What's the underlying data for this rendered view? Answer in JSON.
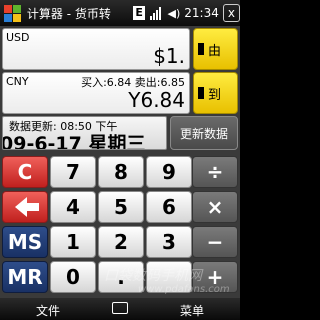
{
  "statusbar": {
    "app_title": "计算器 - 货币转",
    "badge": "E",
    "time": "21:34",
    "close": "x"
  },
  "converter": {
    "from_code": "USD",
    "from_value": "$1.",
    "to_code": "CNY",
    "to_value": "Y6.84",
    "rate_text": "买入:6.84 卖出:6.85",
    "from_button": "由",
    "to_button": "到"
  },
  "info": {
    "update_text": "数据更新:  08:50 下午",
    "date_text": "09-6-17 星期三",
    "update_button": "更新数据"
  },
  "keypad": {
    "clear": "C",
    "backspace": "backspace",
    "ms": "MS",
    "mr": "MR",
    "d7": "7",
    "d8": "8",
    "d9": "9",
    "d4": "4",
    "d5": "5",
    "d6": "6",
    "d1": "1",
    "d2": "2",
    "d3": "3",
    "d0": "0",
    "dot": ".",
    "divide": "÷",
    "multiply": "×",
    "minus": "−",
    "plus": "+"
  },
  "menubar": {
    "left": "文件",
    "right": "菜单"
  },
  "watermark": {
    "line1": "口袋数码手机网",
    "line2": "www.pdafans.com"
  },
  "colors": {
    "accent_yellow": "#ffd700",
    "red_key": "#d83a36",
    "blue_key": "#233f78"
  }
}
